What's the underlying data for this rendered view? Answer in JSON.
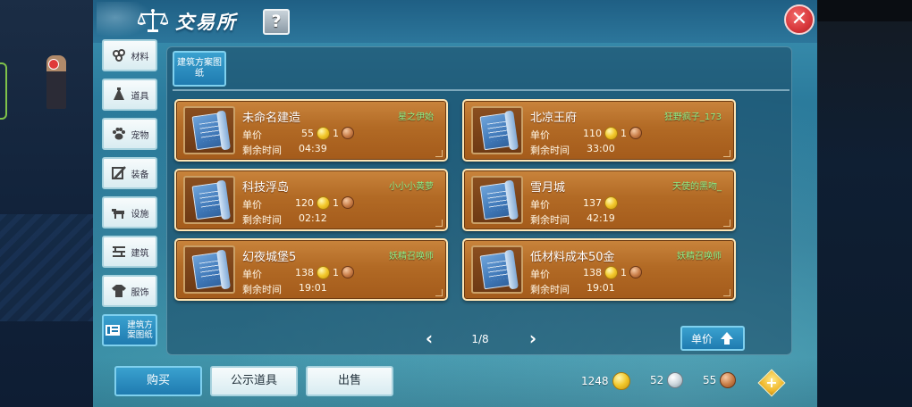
{
  "window": {
    "title": "交易所",
    "help_label": "?",
    "close_label": "✕"
  },
  "side_tabs": [
    {
      "label": "材料",
      "icon": "material-icon"
    },
    {
      "label": "道具",
      "icon": "item-icon"
    },
    {
      "label": "宠物",
      "icon": "paw-icon"
    },
    {
      "label": "装备",
      "icon": "equipment-icon"
    },
    {
      "label": "设施",
      "icon": "facility-icon"
    },
    {
      "label": "建筑",
      "icon": "building-icon"
    },
    {
      "label": "服饰",
      "icon": "clothing-icon"
    },
    {
      "label": "建筑方案图纸",
      "icon": "blueprint-icon",
      "active": true
    }
  ],
  "sub_tab": {
    "label": "建筑方案图纸"
  },
  "listing_labels": {
    "price": "单价",
    "time_left": "剩余时间"
  },
  "listings": [
    {
      "name": "未命名建造",
      "seller": "星之伊始",
      "price": "55",
      "copper": "1",
      "time_left": "04:39"
    },
    {
      "name": "北凉王府",
      "seller": "狂野疯子_173",
      "price": "110",
      "copper": "1",
      "time_left": "33:00"
    },
    {
      "name": "科技浮岛",
      "seller": "小小小黄萝",
      "price": "120",
      "copper": "1",
      "time_left": "02:12"
    },
    {
      "name": "雪月城",
      "seller": "天使的黑吻_",
      "price": "137",
      "copper": "",
      "time_left": "42:19"
    },
    {
      "name": "幻夜城堡5",
      "seller": "妖精召唤师",
      "price": "138",
      "copper": "1",
      "time_left": "19:01"
    },
    {
      "name": "低材料成本50金",
      "seller": "妖精召唤师",
      "price": "138",
      "copper": "1",
      "time_left": "19:01"
    }
  ],
  "pagination": {
    "current": "1/8"
  },
  "sort_button": {
    "label": "单价"
  },
  "bottom": {
    "buy_label": "购买",
    "display_label": "公示道具",
    "sell_label": "出售",
    "gold": "1248",
    "silver": "52",
    "copper": "55"
  },
  "colors": {
    "card_top": "#c9843c",
    "card_bottom": "#a45b1b",
    "seller_green": "#8df08a",
    "active_blue": "#1f7bb0",
    "close_red": "#d7363a"
  }
}
